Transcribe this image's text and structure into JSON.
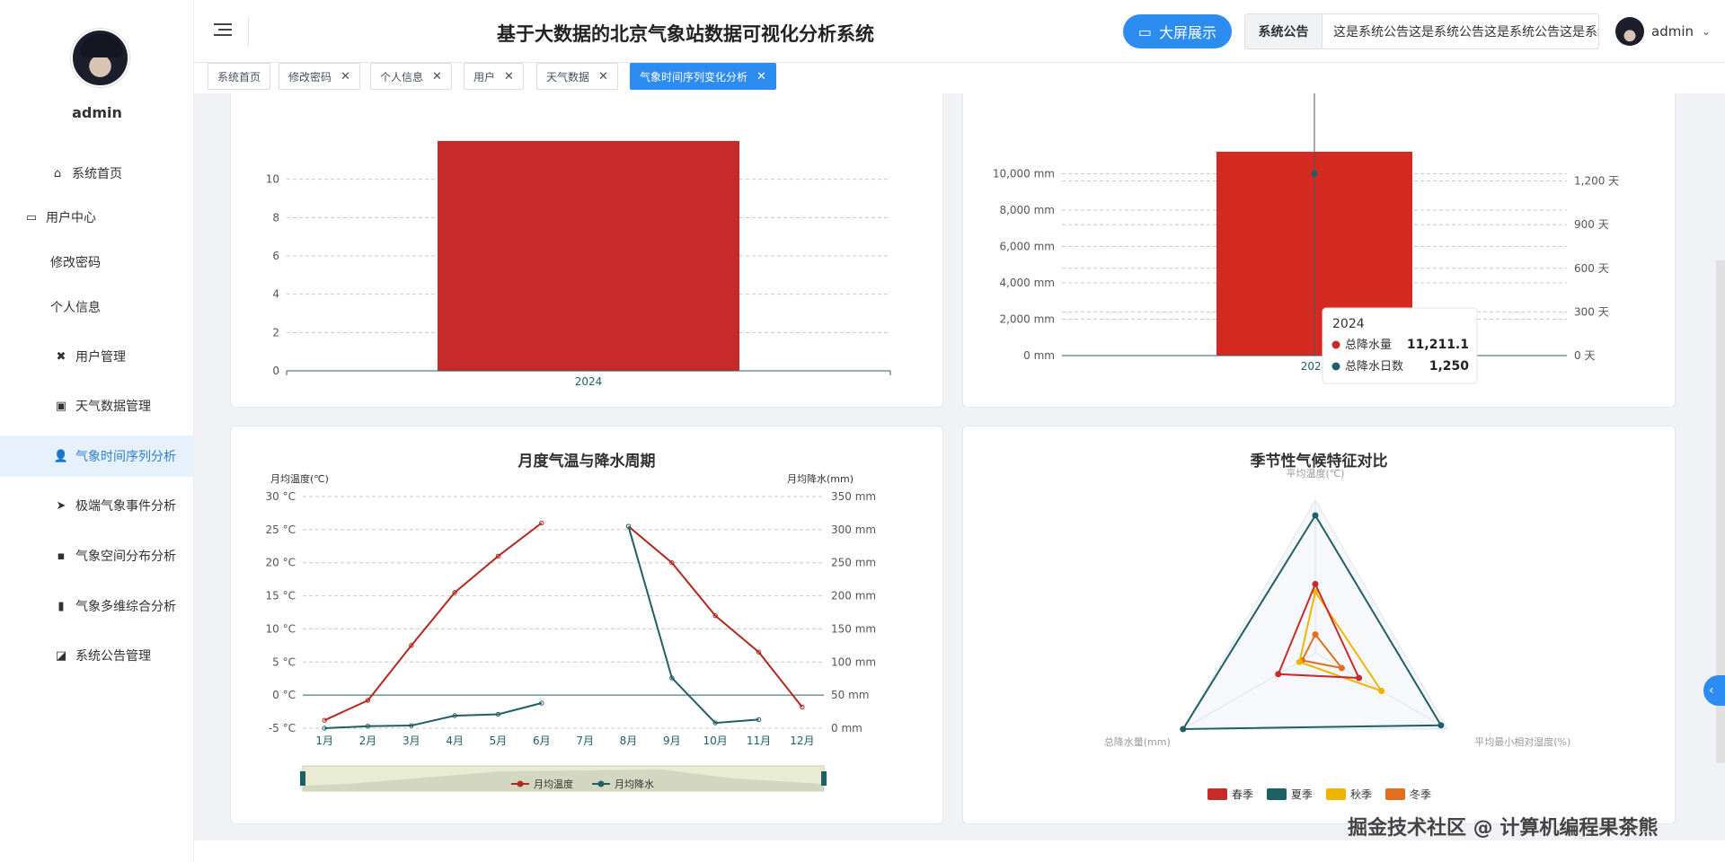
{
  "sidebar": {
    "username": "admin",
    "items": [
      {
        "label": "系统首页",
        "icon": "home-icon",
        "glyph": "⌂"
      },
      {
        "label": "用户中心",
        "icon": "user-center-icon",
        "glyph": "▭"
      },
      {
        "label": "修改密码",
        "icon": "",
        "glyph": ""
      },
      {
        "label": "个人信息",
        "icon": "",
        "glyph": ""
      },
      {
        "label": "用户管理",
        "icon": "user-manage-icon",
        "glyph": "✖"
      },
      {
        "label": "天气数据管理",
        "icon": "weather-data-icon",
        "glyph": "▣"
      },
      {
        "label": "气象时间序列分析",
        "icon": "person-icon",
        "glyph": "👤"
      },
      {
        "label": "极端气象事件分析",
        "icon": "paper-plane-icon",
        "glyph": "➤"
      },
      {
        "label": "气象空间分布分析",
        "icon": "comment-icon",
        "glyph": "▪"
      },
      {
        "label": "气象多维综合分析",
        "icon": "bar-chart-icon",
        "glyph": "▮"
      },
      {
        "label": "系统公告管理",
        "icon": "line-chart-icon",
        "glyph": "◪"
      }
    ]
  },
  "header": {
    "title": "基于大数据的北京气象站数据可视化分析系统",
    "bigscreen_label": "大屏展示",
    "notice_label": "系统公告",
    "notice_text": "这是系统公告这是系统公告这是系统公告这是系统公告",
    "user": "admin"
  },
  "tabs": [
    {
      "label": "系统首页",
      "closable": false
    },
    {
      "label": "修改密码",
      "closable": true
    },
    {
      "label": "个人信息",
      "closable": true
    },
    {
      "label": "用户",
      "closable": true
    },
    {
      "label": "天气数据",
      "closable": true
    },
    {
      "label": "气象时间序列变化分析",
      "closable": true,
      "active": true
    }
  ],
  "charts": {
    "top_left": {
      "type": "bar",
      "categories": [
        "2024"
      ],
      "values": [
        12
      ],
      "yticks": [
        "0",
        "2",
        "4",
        "6",
        "8",
        "10"
      ],
      "color": "#c62a2a"
    },
    "top_right": {
      "type": "bar",
      "categories": [
        "2024"
      ],
      "values": [
        11211.1
      ],
      "left_ticks": [
        "0 mm",
        "2,000 mm",
        "4,000 mm",
        "6,000 mm",
        "8,000 mm",
        "10,000 mm"
      ],
      "right_ticks": [
        "0 天",
        "300 天",
        "600 天",
        "900 天",
        "1,200 天"
      ],
      "line_values": [
        1250
      ],
      "legend": [
        "总降水量",
        "总降水日数"
      ],
      "tooltip": {
        "title": "2024",
        "rows": [
          {
            "name": "总降水量",
            "value": "11,211.1",
            "color": "#c62a2a"
          },
          {
            "name": "总降水日数",
            "value": "1,250",
            "color": "#1f5f66"
          }
        ]
      }
    },
    "monthly": {
      "type": "line",
      "title": "月度气温与降水周期",
      "y_left_name": "月均温度(℃)",
      "y_right_name": "月均降水(mm)",
      "left_ticks": [
        "-5 °C",
        "0 °C",
        "5 °C",
        "10 °C",
        "15 °C",
        "20 °C",
        "25 °C",
        "30 °C"
      ],
      "right_ticks": [
        "0 mm",
        "50 mm",
        "100 mm",
        "150 mm",
        "200 mm",
        "250 mm",
        "300 mm",
        "350 mm"
      ],
      "months": [
        "1月",
        "2月",
        "3月",
        "4月",
        "5月",
        "6月",
        "7月",
        "8月",
        "9月",
        "10月",
        "11月",
        "12月"
      ],
      "temp": [
        -3.8,
        -0.8,
        7.5,
        15.5,
        21,
        26,
        null,
        25.5,
        20,
        12,
        6.5,
        -1.8
      ],
      "precip": [
        0,
        3,
        4,
        19,
        21,
        38,
        null,
        305,
        76,
        8,
        13,
        null
      ],
      "legend": [
        "月均温度",
        "月均降水"
      ]
    },
    "seasonal": {
      "type": "radar",
      "title": "季节性气候特征对比",
      "indicators": [
        "平均温度(℃)",
        "平均最小相对湿度(%)",
        "总降水量(mm)"
      ],
      "series": [
        {
          "name": "春季",
          "color": "#c62a2a",
          "values": [
            0.45,
            0.33,
            0.28
          ]
        },
        {
          "name": "夏季",
          "color": "#1f5f66",
          "values": [
            0.9,
            0.95,
            1.0
          ]
        },
        {
          "name": "秋季",
          "color": "#f0b400",
          "values": [
            0.4,
            0.5,
            0.12
          ]
        },
        {
          "name": "冬季",
          "color": "#e07020",
          "values": [
            0.12,
            0.2,
            0.1
          ]
        }
      ]
    }
  },
  "watermark": "掘金技术社区 @ 计算机编程果茶熊"
}
